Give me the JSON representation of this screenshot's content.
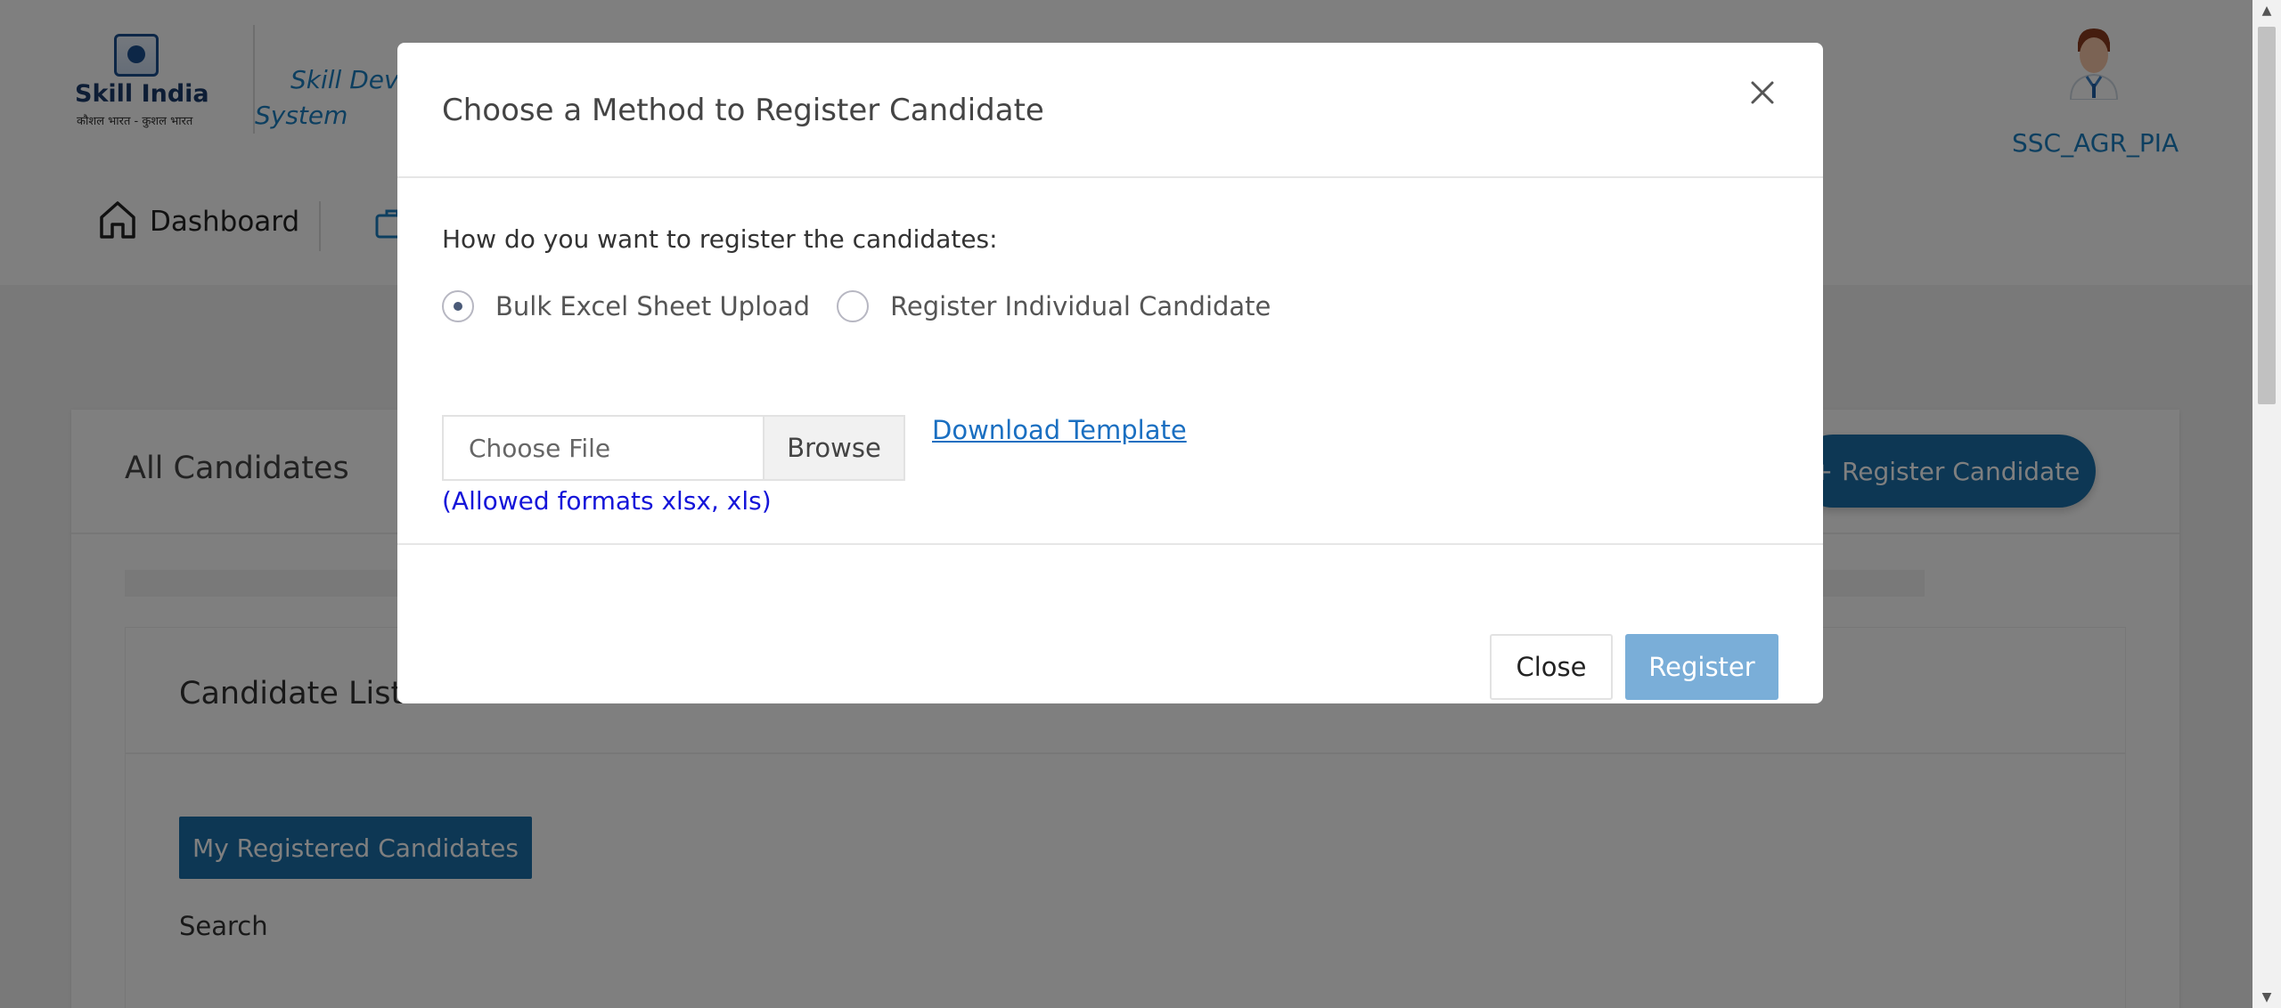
{
  "header": {
    "logo_text": "Skill India",
    "logo_subtext": "कौशल भारत - कुशल भारत",
    "system_title_line1": "Skill Deve",
    "system_title_line2": "System",
    "nav": {
      "dashboard_label": "Dashboard",
      "dashboard_icon": "home-icon",
      "second_icon": "briefcase-icon"
    },
    "user": {
      "name": "SSC_AGR_PIA",
      "avatar_icon": "user-avatar-icon"
    }
  },
  "page": {
    "title": "All Candidates",
    "register_candidate_button": "Register Candidate",
    "candidate_list_title": "Candidate List",
    "my_registered_button": "My Registered Candidates",
    "search_label": "Search"
  },
  "modal": {
    "title": "Choose a Method to Register Candidate",
    "question": "How do you want to register the candidates:",
    "options": [
      {
        "label": "Bulk Excel Sheet Upload",
        "checked": true
      },
      {
        "label": "Register Individual Candidate",
        "checked": false
      }
    ],
    "file_placeholder": "Choose File",
    "browse_label": "Browse",
    "download_template_label": "Download Template",
    "allowed_formats": "(Allowed formats xlsx, xls)",
    "close_label": "Close",
    "register_label": "Register"
  },
  "colors": {
    "primary": "#1a6fa8",
    "link": "#1a6fc1",
    "register_disabled": "#7aaed8",
    "allowed_text": "#1515d9"
  }
}
